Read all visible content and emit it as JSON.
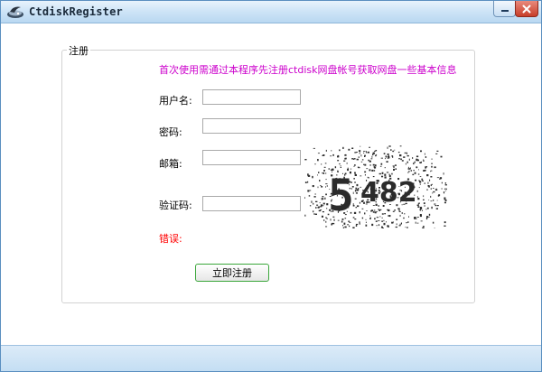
{
  "window": {
    "title": "CtdiskRegister",
    "accent_color": "#bcd9f2",
    "icons": {
      "app": "ctdisk-logo-icon",
      "minimize": "minimize-icon",
      "close": "close-icon"
    }
  },
  "form": {
    "group_title": "注册",
    "notice": "首次使用需通过本程序先注册ctdisk网盘帐号获取网盘一些基本信息",
    "notice_color": "#cc00cc",
    "fields": {
      "username": {
        "label": "用户名:",
        "value": ""
      },
      "password": {
        "label": "密码:",
        "value": ""
      },
      "email": {
        "label": "邮箱:",
        "value": ""
      },
      "captcha": {
        "label": "验证码:",
        "value": ""
      }
    },
    "captcha_image_text": "5482",
    "error_label": "错误:",
    "error_color": "#ff0000",
    "submit_label": "立即注册"
  }
}
